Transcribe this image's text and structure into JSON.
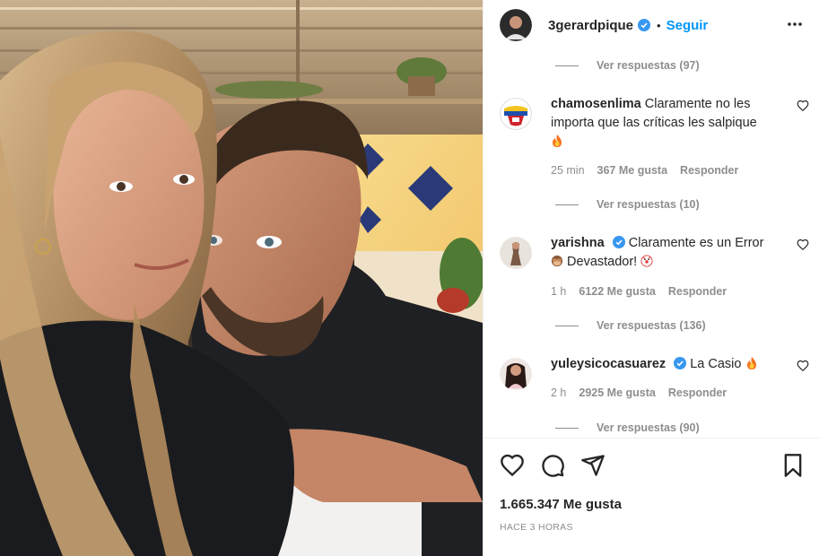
{
  "post": {
    "username": "3gerardpique",
    "follow_label": "Seguir",
    "likes": "1.665.347 Me gusta",
    "timestamp": "HACE 3 HORAS"
  },
  "comments": [
    {
      "replies": "Ver respuestas (97)"
    },
    {
      "username": "chamosenlima",
      "text": "Claramente no les importa que las críticas les salpique",
      "emoji": "fire",
      "time": "25 min",
      "likes": "367 Me gusta",
      "reply": "Responder",
      "replies": "Ver respuestas (10)"
    },
    {
      "username": "yarishna",
      "verified": true,
      "text": "Claramente es un Error",
      "text2": "Devastador!",
      "time": "1 h",
      "likes": "6122 Me gusta",
      "reply": "Responder",
      "replies": "Ver respuestas (136)"
    },
    {
      "username": "yuleysicocasuarez",
      "verified": true,
      "text": "La Casio",
      "emoji": "fire",
      "time": "2 h",
      "likes": "2925 Me gusta",
      "reply": "Responder",
      "replies": "Ver respuestas (90)"
    }
  ],
  "icons": {
    "more": "more-options-icon",
    "like": "heart-icon",
    "comment": "comment-icon",
    "share": "share-icon",
    "save": "bookmark-icon"
  },
  "colors": {
    "link": "#0095f6",
    "verified": "#3897f0",
    "muted": "#8e8e8e",
    "text": "#262626"
  }
}
